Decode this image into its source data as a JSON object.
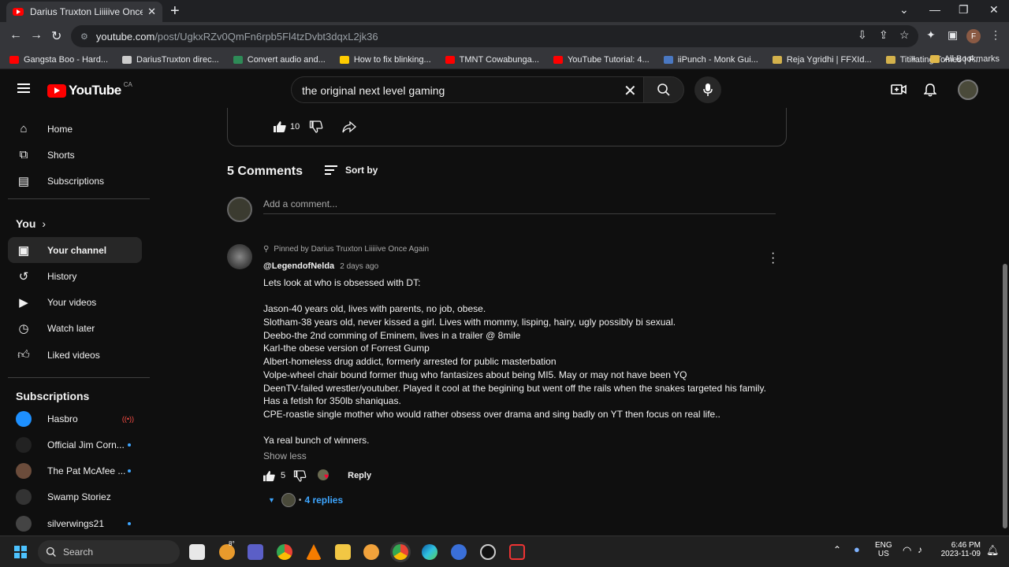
{
  "browser": {
    "tab_title": "Darius Truxton Liiiiive Once Again",
    "new_tab": "+",
    "close_tab": "✕",
    "url_host": "youtube.com",
    "url_path": "/post/UgkxRZv0QmFn6rpb5Fl4tzDvbt3dqxL2jk36",
    "profile_initial": "F",
    "bookmarks": [
      {
        "label": "Gangsta Boo - Hard...",
        "color": "#ff0000"
      },
      {
        "label": "DariusTruxton direc...",
        "color": "#cccccc"
      },
      {
        "label": "Convert audio and...",
        "color": "#2e8b57"
      },
      {
        "label": "How to fix blinking...",
        "color": "#ffcc00"
      },
      {
        "label": "TMNT Cowabunga...",
        "color": "#ff0000"
      },
      {
        "label": "YouTube Tutorial: 4...",
        "color": "#ff0000"
      },
      {
        "label": "iiPunch - Monk Gui...",
        "color": "#4a78c2"
      },
      {
        "label": "Reja Ygridhi | FFXId...",
        "color": "#d4b24c"
      },
      {
        "label": "Titillating Tomes | F...",
        "color": "#d4b24c"
      }
    ],
    "bookmarks_more": "»",
    "all_bookmarks": "All Bookmarks"
  },
  "youtube": {
    "logo_text": "YouTube",
    "country_code": "CA",
    "search_value": "the original next level gaming"
  },
  "sidebar": {
    "main_items": [
      {
        "label": "Home",
        "icon": "home-icon"
      },
      {
        "label": "Shorts",
        "icon": "shorts-icon"
      },
      {
        "label": "Subscriptions",
        "icon": "subscriptions-icon"
      }
    ],
    "you_heading": "You",
    "you_items": [
      {
        "label": "Your channel",
        "icon": "channel-icon",
        "active": true
      },
      {
        "label": "History",
        "icon": "history-icon"
      },
      {
        "label": "Your videos",
        "icon": "videos-icon"
      },
      {
        "label": "Watch later",
        "icon": "clock-icon"
      },
      {
        "label": "Liked videos",
        "icon": "thumbs-up-icon"
      }
    ],
    "subs_heading": "Subscriptions",
    "subscriptions": [
      {
        "label": "Hasbro",
        "indicator": "live"
      },
      {
        "label": "Official Jim Corn...",
        "indicator": "new"
      },
      {
        "label": "The Pat McAfee ...",
        "indicator": "new"
      },
      {
        "label": "Swamp Storiez",
        "indicator": "none"
      },
      {
        "label": "silverwings21",
        "indicator": "new"
      }
    ]
  },
  "post": {
    "likes": "10"
  },
  "comments": {
    "heading": "5 Comments",
    "sort_label": "Sort by",
    "add_placeholder": "Add a comment...",
    "pinned_by": "Pinned by Darius Truxton Liiiiive Once Again",
    "author": "@LegendofNelda",
    "time": "2 days ago",
    "lines": [
      "Lets look at who is obsessed with DT:",
      "",
      "Jason-40 years old, lives with parents, no job, obese.",
      "Slotham-38 years old, never kissed a girl. Lives with mommy, lisping, hairy, ugly possibly bi sexual.",
      "Deebo-the 2nd comming of Eminem, lives in a trailer @ 8mile",
      "Karl-the obese version of Forrest Gump",
      "Albert-homeless drug addict, formerly arrested for public masterbation",
      "Volpe-wheel chair bound former thug who fantasizes about being MI5. May or may not have been YQ",
      "DeenTV-failed wrestler/youtuber. Played it cool at the begining but went off the rails when the snakes targeted his family.",
      "Has a fetish for 350lb shaniquas.",
      "CPE-roastie single mother who would rather obsess over drama and sing badly on YT then focus on real life..",
      "",
      "Ya real bunch of winners."
    ],
    "show_less": "Show less",
    "comment_likes": "5",
    "reply_label": "Reply",
    "replies_label": "4 replies"
  },
  "taskbar": {
    "search_label": "Search",
    "lang_top": "ENG",
    "lang_bottom": "US",
    "time": "6:46 PM",
    "date": "2023-11-09",
    "weather_badge": "8°"
  }
}
